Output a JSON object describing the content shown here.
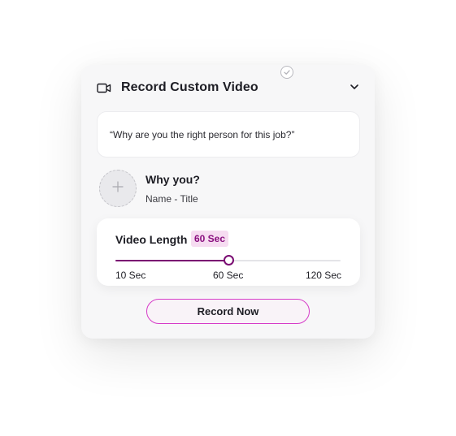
{
  "header": {
    "title": "Record Custom Video",
    "icon": "video-camera-icon",
    "collapse_icon": "chevron-down-icon"
  },
  "question": {
    "text": "“Why are you the right person for this job?”"
  },
  "person": {
    "avatar_icon": "plus-icon",
    "name": "Why you?",
    "title": "Name - Title"
  },
  "video_length": {
    "label": "Video Length",
    "badge": "60 Sec",
    "min_label": "10 Sec",
    "mid_label": "60 Sec",
    "max_label": "120 Sec",
    "min": 10,
    "max": 120,
    "value_fraction": 0.5
  },
  "actions": {
    "record_label": "Record Now"
  },
  "colors": {
    "accent": "#7a0b72",
    "button_border": "#d63bc8",
    "badge_bg": "#f6dcf1",
    "badge_text": "#8a0f7f"
  }
}
